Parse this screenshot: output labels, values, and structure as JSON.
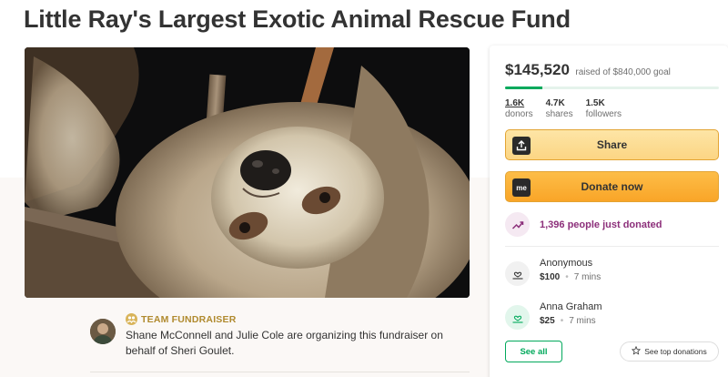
{
  "page": {
    "title": "Little Ray's Largest Exotic Animal Rescue Fund"
  },
  "team": {
    "badge_label": "TEAM FUNDRAISER",
    "description": "Shane McConnell and Julie Cole are organizing this fundraiser on behalf of Sheri Goulet."
  },
  "card": {
    "raised_amount": "$145,520",
    "goal_text": "raised of $840,000 goal",
    "progress_fraction": 0.173,
    "stats": [
      {
        "value": "1.6K",
        "label": "donors"
      },
      {
        "value": "4.7K",
        "label": "shares"
      },
      {
        "value": "1.5K",
        "label": "followers"
      }
    ],
    "share_label": "Share",
    "donate_label": "Donate now",
    "donate_icon_text": "me",
    "trend_text": "1,396 people just donated",
    "donors": [
      {
        "name": "Anonymous",
        "amount": "$100",
        "time": "7 mins"
      },
      {
        "name": "Anna Graham",
        "amount": "$25",
        "time": "7 mins"
      }
    ],
    "see_all_label": "See all",
    "see_top_label": "See top donations"
  },
  "colors": {
    "brand_green": "#02a95c",
    "donate_orange": "#f9a528",
    "share_yellow": "#fcd583",
    "trend_purple": "#8c2f7a"
  },
  "icons": {
    "share": "upload-icon",
    "donate": "gofundme-me-icon",
    "trend": "trending-up-icon",
    "donor": "hand-heart-icon",
    "top": "star-icon",
    "badge": "team-fundraiser-icon"
  }
}
